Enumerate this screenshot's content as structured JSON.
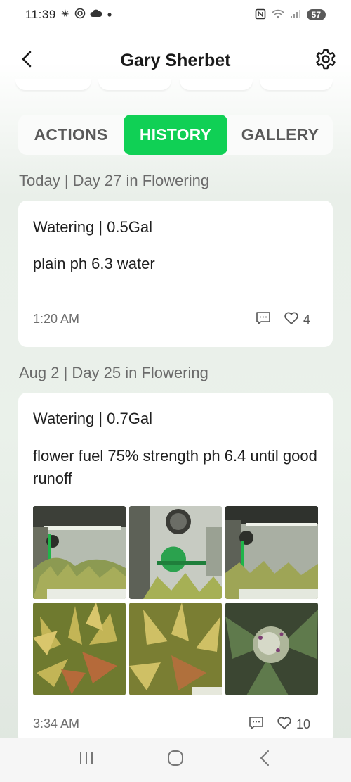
{
  "status_bar": {
    "time": "11:39",
    "battery": "57",
    "icons": [
      "cannabis-leaf-icon",
      "at-sign-icon",
      "cloud-icon",
      "dot-icon",
      "nfc-icon",
      "wifi-icon",
      "signal-icon",
      "battery-icon"
    ]
  },
  "header": {
    "title": "Gary Sherbet",
    "back_icon": "chevron-left-icon",
    "settings_icon": "gear-icon"
  },
  "tabs": [
    {
      "label": "ACTIONS",
      "active": false
    },
    {
      "label": "HISTORY",
      "active": true
    },
    {
      "label": "GALLERY",
      "active": false
    }
  ],
  "colors": {
    "accent": "#10d055",
    "tab_inactive_text": "#595959",
    "section_label": "#6b6b6b"
  },
  "history": [
    {
      "section_label": "Today | Day 27 in Flowering",
      "title": "Watering | 0.5Gal",
      "note": "plain ph 6.3 water",
      "time": "1:20 AM",
      "likes": "4",
      "photos": []
    },
    {
      "section_label": "Aug 2 | Day 25 in Flowering",
      "title": "Watering | 0.7Gal",
      "note": "flower fuel 75% strength ph 6.4 until good runoff",
      "time": "3:34 AM",
      "likes": "10",
      "photos": [
        "grow-tent-photo",
        "grow-tent-fan-photo",
        "grow-tent-lights-photo",
        "leaves-closeup-photo",
        "leaves-closeup-photo",
        "bud-closeup-photo"
      ]
    }
  ],
  "nav_bar": {
    "recents_icon": "recent-apps-icon",
    "home_icon": "home-icon",
    "back_icon": "back-icon"
  }
}
